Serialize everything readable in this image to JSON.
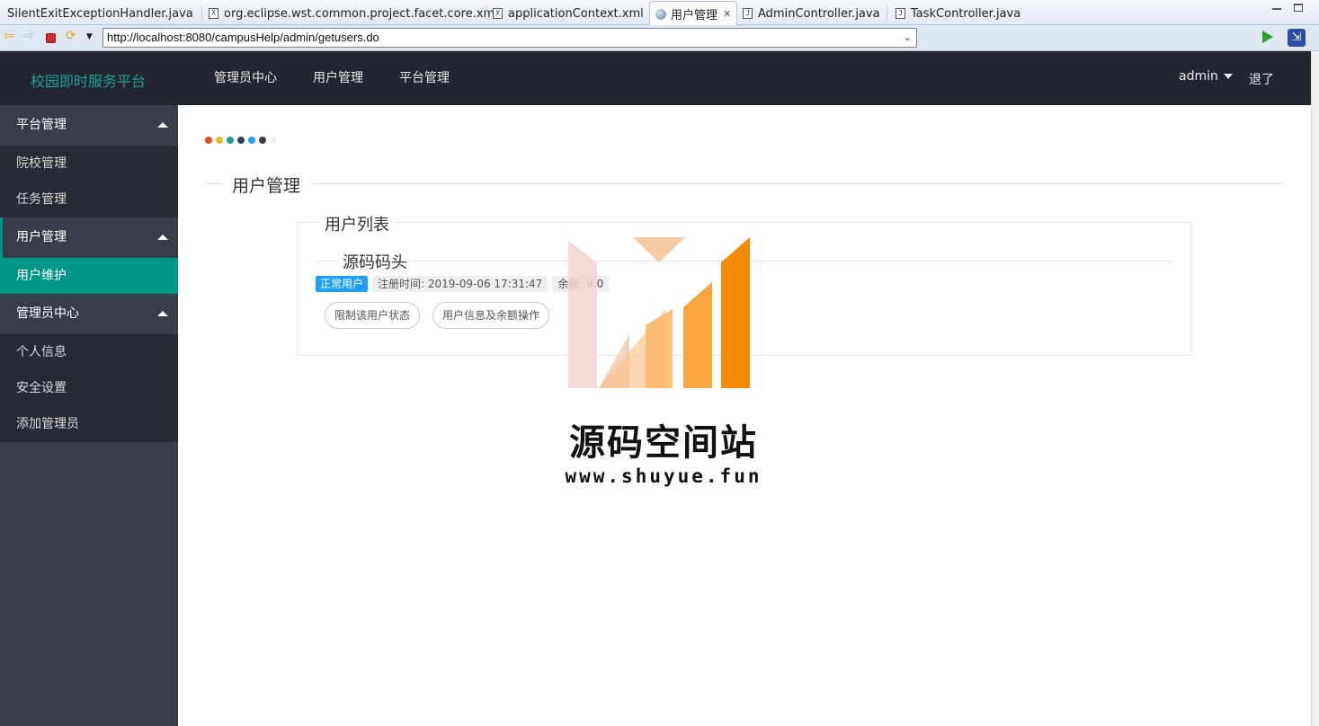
{
  "ide_tabs": [
    {
      "label": "SilentExitExceptionHandler.java",
      "icon": "java-file-icon"
    },
    {
      "label": "org.eclipse.wst.common.project.facet.core.xml",
      "icon": "xml-file-icon"
    },
    {
      "label": "applicationContext.xml",
      "icon": "xml-file-icon"
    },
    {
      "label": "用户管理",
      "icon": "globe-icon",
      "active": true
    },
    {
      "label": "AdminController.java",
      "icon": "java-file-icon"
    },
    {
      "label": "TaskController.java",
      "icon": "java-file-icon"
    }
  ],
  "browser": {
    "url": "http://localhost:8080/campusHelp/admin/getusers.do"
  },
  "header": {
    "brand": "校园即时服务平台",
    "nav": [
      "管理员中心",
      "用户管理",
      "平台管理"
    ],
    "user": "admin",
    "logout": "退了"
  },
  "sidebar": {
    "groups": [
      {
        "label": "平台管理",
        "items": [
          "院校管理",
          "任务管理"
        ]
      },
      {
        "label": "用户管理",
        "items": [
          "用户维护"
        ],
        "active_item": "用户维护"
      },
      {
        "label": "管理员中心",
        "items": [
          "个人信息",
          "安全设置",
          "添加管理员"
        ]
      }
    ]
  },
  "main": {
    "dot_colors": [
      "#e64b25",
      "#f3b91d",
      "#1aa094",
      "#2f4056",
      "#1e9fff",
      "#393d49",
      "#eeeeee"
    ],
    "section_title": "用户管理",
    "panel_legend": "用户列表",
    "user_card": {
      "name": "源码码头",
      "status": "正常用户",
      "register_time": "注册时间: 2019-09-06 17:31:47",
      "balance": "余额: 9.0",
      "actions": [
        "限制该用户状态",
        "用户信息及余额操作"
      ]
    }
  },
  "watermark": {
    "title": "源码空间站",
    "url": "www.shuyue.fun"
  },
  "colors": {
    "header_bg": "#23262e",
    "sidebar_bg": "#393d49",
    "accent": "#009688",
    "badge_blue": "#1e9fff"
  }
}
